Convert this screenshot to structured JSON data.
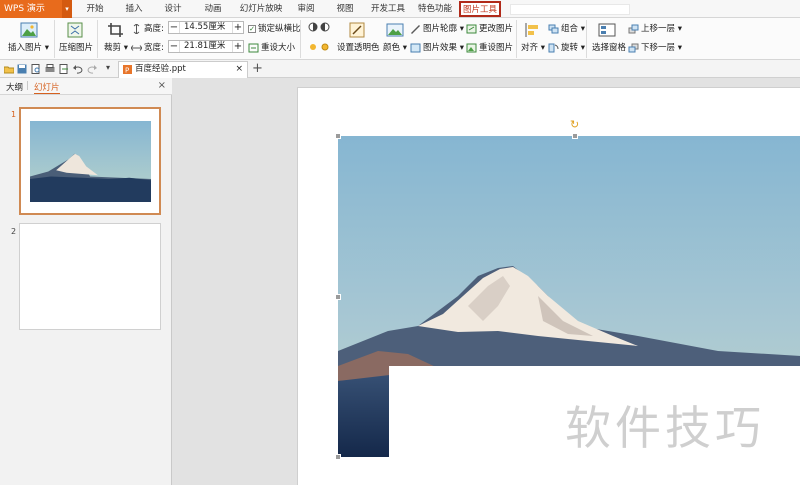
{
  "app": {
    "name": "WPS 演示"
  },
  "menu": {
    "tabs": [
      {
        "label": "开始"
      },
      {
        "label": "插入"
      },
      {
        "label": "设计"
      },
      {
        "label": "动画"
      },
      {
        "label": "幻灯片放映"
      },
      {
        "label": "审阅"
      },
      {
        "label": "视图"
      },
      {
        "label": "开发工具"
      },
      {
        "label": "特色功能"
      },
      {
        "label": "图片工具"
      }
    ],
    "active_tab": "图片工具"
  },
  "ribbon": {
    "insert_picture": "插入图片",
    "compress_picture": "压缩图片",
    "crop": "裁剪",
    "height_label": "高度:",
    "height_value": "14.55厘米",
    "width_label": "宽度:",
    "width_value": "21.81厘米",
    "lock_ratio": "锁定纵横比",
    "reset_size": "重设大小",
    "set_transparent": "设置透明色",
    "color": "颜色",
    "picture_outline": "图片轮廓",
    "picture_effects": "图片效果",
    "change_picture": "更改图片",
    "reset_picture": "重设图片",
    "align": "对齐",
    "group": "组合",
    "rotate": "旋转",
    "selection_pane": "选择窗格",
    "bring_forward": "上移一层",
    "send_backward": "下移一层"
  },
  "document": {
    "tab_name": "百度经验.ppt"
  },
  "left_panel": {
    "tab_outline": "大纲",
    "tab_slides": "幻灯片",
    "slides": [
      {
        "number": "1"
      },
      {
        "number": "2"
      }
    ]
  },
  "watermark": "软件技巧",
  "colors": {
    "app_orange": "#e86b1c",
    "active_tab_border": "#b12a1a",
    "selected_thumb_border": "#d08a53",
    "sky_top": "#86b6d2",
    "sky_bottom": "#b9d3cf"
  }
}
